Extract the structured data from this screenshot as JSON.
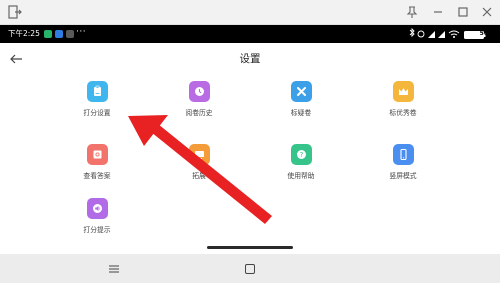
{
  "status_bar": {
    "time": "下午2:25",
    "more": "···",
    "battery": "50"
  },
  "header": {
    "title": "设置"
  },
  "settings_items": [
    {
      "label": "打分设置",
      "icon": "clipboard-icon",
      "color": "#3fb6ee"
    },
    {
      "label": "阅卷历史",
      "icon": "history-icon",
      "color": "#b86be3"
    },
    {
      "label": "标疑卷",
      "icon": "cross-icon",
      "color": "#3ca0e8"
    },
    {
      "label": "标优秀卷",
      "icon": "crown-icon",
      "color": "#f4b63c"
    },
    {
      "label": "查看答案",
      "icon": "answer-icon",
      "color": "#f1736b"
    },
    {
      "label": "拓展",
      "icon": "monitor-icon",
      "color": "#f59c3a"
    },
    {
      "label": "使用帮助",
      "icon": "help-icon",
      "color": "#36c48b"
    },
    {
      "label": "竖屏模式",
      "icon": "phone-icon",
      "color": "#4a8ef0"
    },
    {
      "label": "打分提示",
      "icon": "sound-icon",
      "color": "#b16be6"
    }
  ],
  "annotation": {
    "color": "#e82222",
    "points_to": "打分设置"
  }
}
